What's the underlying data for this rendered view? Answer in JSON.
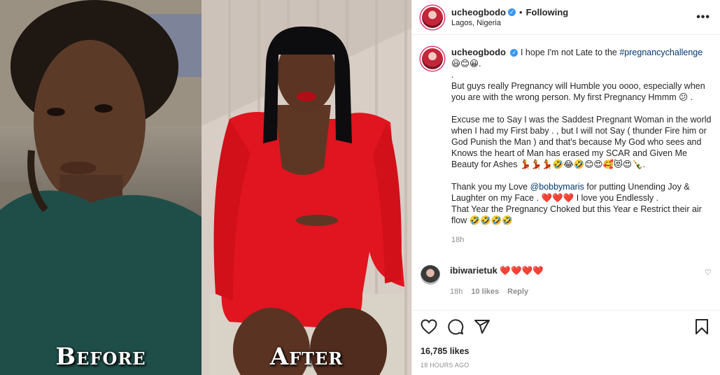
{
  "post": {
    "username": "ucheogbodo",
    "follow_state": "Following",
    "location": "Lagos, Nigeria",
    "dot": "•",
    "more": "•••",
    "verified_icon": "verified-badge-icon"
  },
  "media": {
    "before_label": "Before",
    "after_label": "After"
  },
  "caption": {
    "username": "ucheogbodo",
    "intro": "I hope I'm not Late to the ",
    "hashtag": "#pregnancychallenge",
    "line1_tail": " 😃😊😀.",
    "line2": ".",
    "line3": "But guys really Pregnancy will Humble you oooo, especially when you are with the wrong person. My first Pregnancy Hmmm 😕 .",
    "line4": "",
    "line5": "Excuse me to Say I was the Saddest Pregnant Woman in the world when I had my First baby . , but I will not Say ( thunder Fire him or God Punish the Man ) and that's because My God who sees and Knows the heart of Man has erased my SCAR and Given Me Beauty for Ashes 💃💃💃🤣😂🤣😊😍🥰😻😍🍾.",
    "line6": "",
    "line7_pre": "Thank you my Love ",
    "mention": "@bobbymaris",
    "line7_post": " for putting Unending Joy & Laughter on my Face . ❤️❤️❤️ I love you Endlessly .",
    "line8": "That Year the Pregnancy Choked but this Year e Restrict their air flow 🤣🤣🤣🤣",
    "time": "18h"
  },
  "comment": {
    "username": "ibiwarietuk",
    "text": " ❤️❤️❤️❤️",
    "time": "18h",
    "likes": "10 likes",
    "reply": "Reply",
    "like_icon": "♡"
  },
  "actions": {
    "likes": "16,785 likes",
    "timestamp": "18 HOURS AGO"
  },
  "colors": {
    "accent_link": "#00376b",
    "verified": "#3897f0",
    "meta_gray": "#8e8e8e"
  }
}
